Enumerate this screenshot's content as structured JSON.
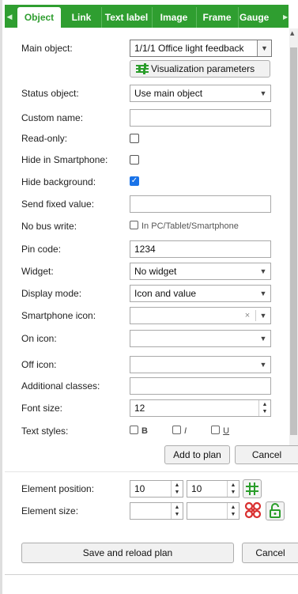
{
  "tabs": [
    "Object",
    "Link",
    "Text label",
    "Image",
    "Frame",
    "Gauge"
  ],
  "fields": {
    "main_object": {
      "label": "Main object:",
      "value": "1/1/1 Office light feedback"
    },
    "vis_button": "Visualization parameters",
    "status_object": {
      "label": "Status object:",
      "value": "Use main object"
    },
    "custom_name": {
      "label": "Custom name:",
      "value": ""
    },
    "read_only": {
      "label": "Read-only:",
      "checked": false
    },
    "hide_smartphone": {
      "label": "Hide in Smartphone:",
      "checked": false
    },
    "hide_background": {
      "label": "Hide background:",
      "checked": true
    },
    "send_fixed": {
      "label": "Send fixed value:",
      "value": ""
    },
    "no_bus_write": {
      "label": "No bus write:",
      "option": "In PC/Tablet/Smartphone"
    },
    "pin_code": {
      "label": "Pin code:",
      "value": "1234"
    },
    "widget": {
      "label": "Widget:",
      "value": "No widget"
    },
    "display_mode": {
      "label": "Display mode:",
      "value": "Icon and value"
    },
    "smartphone_icon": {
      "label": "Smartphone icon:",
      "value": ""
    },
    "on_icon": {
      "label": "On icon:",
      "value": ""
    },
    "off_icon": {
      "label": "Off icon:",
      "value": ""
    },
    "additional_classes": {
      "label": "Additional classes:",
      "value": ""
    },
    "font_size": {
      "label": "Font size:",
      "value": "12"
    },
    "text_styles": {
      "label": "Text styles:",
      "bold": "B",
      "italic": "I",
      "underline": "U"
    }
  },
  "buttons": {
    "add_to_plan": "Add to plan",
    "cancel": "Cancel",
    "save_reload": "Save and reload plan",
    "cancel2": "Cancel"
  },
  "position": {
    "label": "Element position:",
    "x": "10",
    "y": "10"
  },
  "size": {
    "label": "Element size:",
    "w": "",
    "h": ""
  },
  "colors": {
    "tab_green": "#2f9e30",
    "checkbox_blue": "#1a73e8",
    "grid_icon": "#2a9d2a",
    "resize_icon": "#d93030",
    "lock_icon": "#2a9d2a"
  }
}
